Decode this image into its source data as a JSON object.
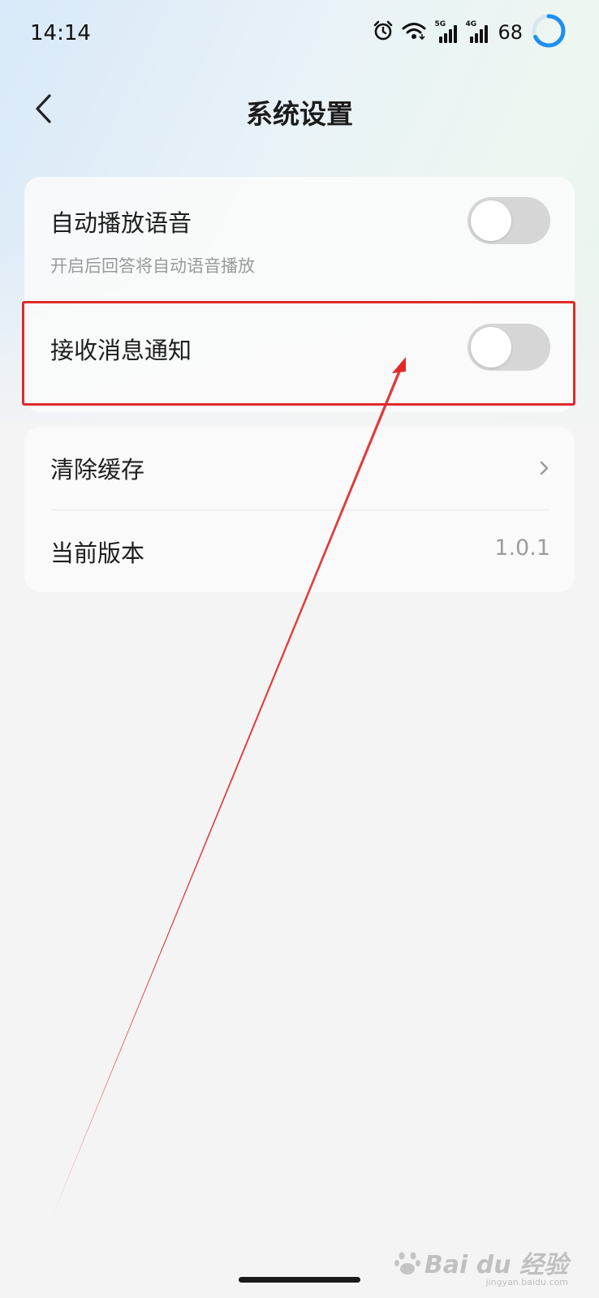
{
  "status_bar": {
    "time": "14:14",
    "signal_1_tag": "5G",
    "signal_2_tag": "4G",
    "battery": "68"
  },
  "header": {
    "title": "系统设置"
  },
  "settings_group_1": {
    "auto_play_voice": {
      "label": "自动播放语音",
      "description": "开启后回答将自动语音播放",
      "enabled": false
    },
    "receive_notifications": {
      "label": "接收消息通知",
      "enabled": false
    }
  },
  "settings_group_2": {
    "clear_cache": {
      "label": "清除缓存"
    },
    "current_version": {
      "label": "当前版本",
      "value": "1.0.1"
    }
  },
  "watermark": {
    "brand": "Bai du 经验",
    "url": "jingyan.baidu.com"
  },
  "colors": {
    "annotation_red": "#e02a2a",
    "battery_ring": "#1e8ff0",
    "toggle_off": "#d6d6d6"
  }
}
